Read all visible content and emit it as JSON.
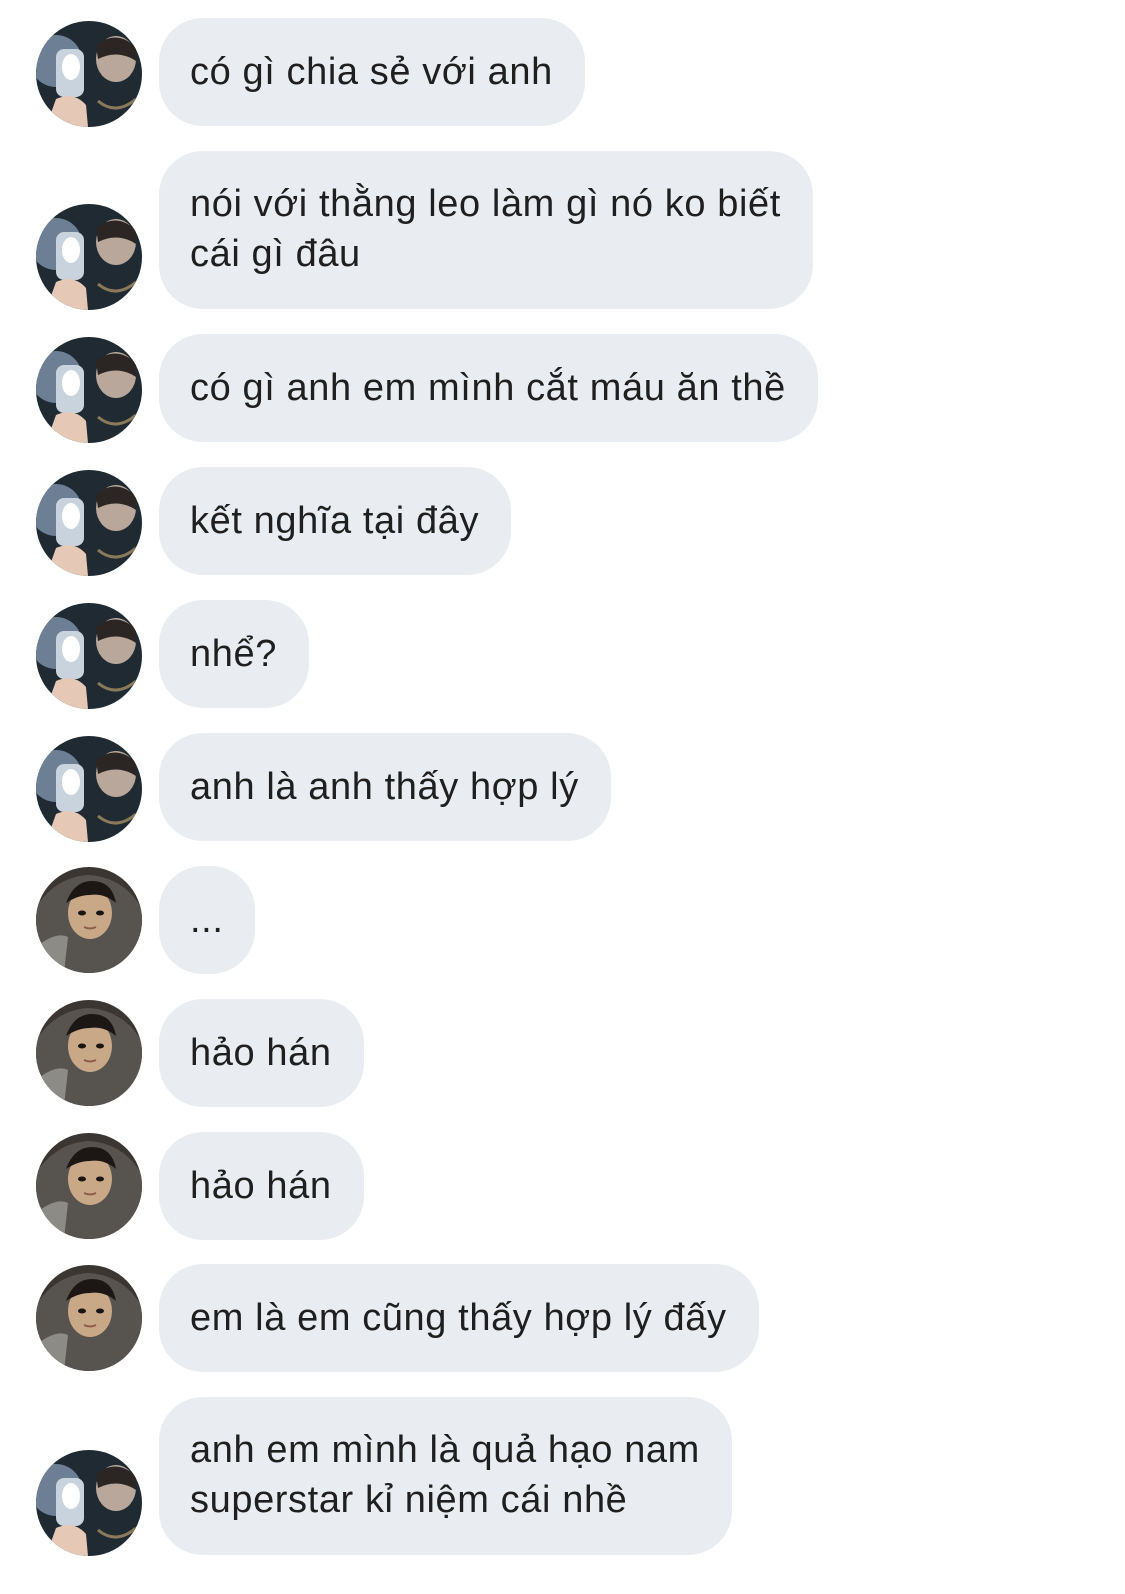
{
  "messages": [
    {
      "sender": "a",
      "text": "có gì chia sẻ với anh"
    },
    {
      "sender": "a",
      "text_lines": [
        "nói với thằng leo làm gì nó ko biết",
        "cái gì đâu"
      ]
    },
    {
      "sender": "a",
      "text": "có gì anh em mình cắt máu ăn thề"
    },
    {
      "sender": "a",
      "text": "kết nghĩa tại đây"
    },
    {
      "sender": "a",
      "text": "nhể?"
    },
    {
      "sender": "a",
      "text": "anh là anh thấy hợp lý"
    },
    {
      "sender": "b",
      "text": "..."
    },
    {
      "sender": "b",
      "text": "hảo hán"
    },
    {
      "sender": "b",
      "text": "hảo hán"
    },
    {
      "sender": "b",
      "text": "em là em cũng thấy hợp lý đấy"
    },
    {
      "sender": "a",
      "text_lines": [
        "anh em mình là quả hạo nam",
        "superstar kỉ niệm cái nhề"
      ]
    }
  ],
  "colors": {
    "bubble": "#e9ecf0",
    "text": "#1f1f1f",
    "background": "#ffffff"
  },
  "icons": {
    "avatar_a": "avatar-mirror-selfie-icon",
    "avatar_b": "avatar-hooded-selfie-icon"
  }
}
